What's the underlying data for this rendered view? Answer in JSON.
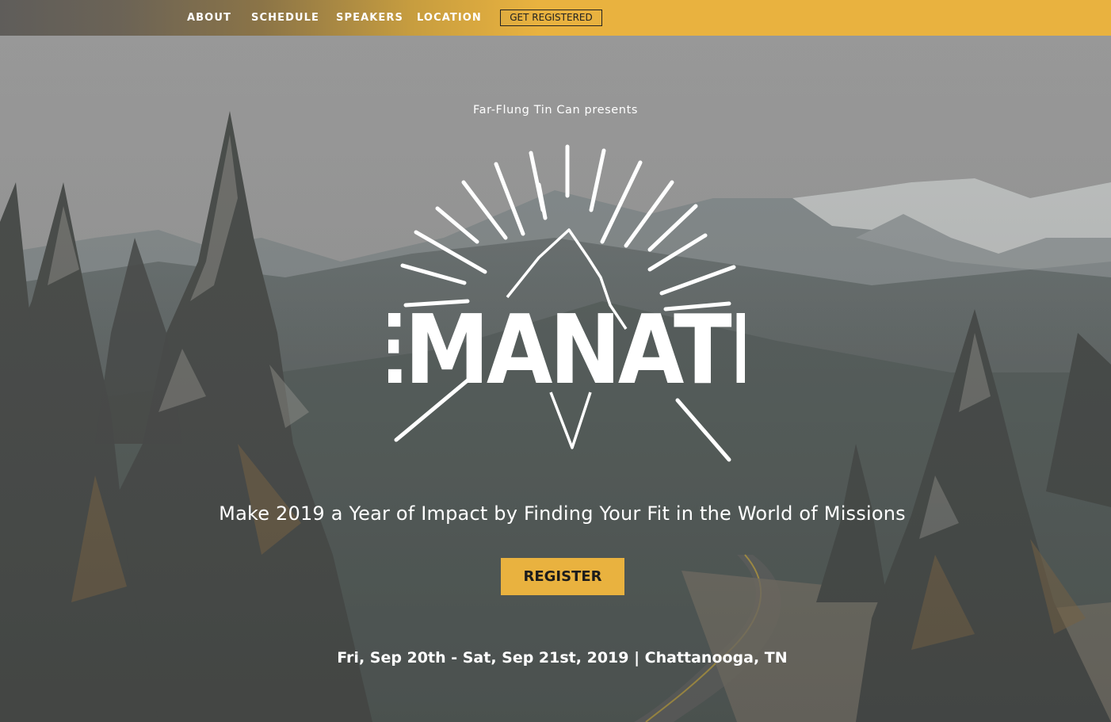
{
  "nav": {
    "links": [
      "ABOUT",
      "SCHEDULE",
      "SPEAKERS",
      "LOCATION"
    ],
    "cta": "GET REGISTERED"
  },
  "hero": {
    "presenter": "Far-Flung Tin Can presents",
    "logo_text": "EMANATE",
    "tagline": "Make 2019 a Year of Impact by Finding Your Fit in the World of Missions",
    "register_label": "REGISTER",
    "event_info": "Fri, Sep 20th - Sat, Sep 21st, 2019 | Chattanooga, TN"
  },
  "colors": {
    "accent": "#e9b23f",
    "text_light": "#ffffff",
    "text_dark": "#1c1c1c"
  }
}
